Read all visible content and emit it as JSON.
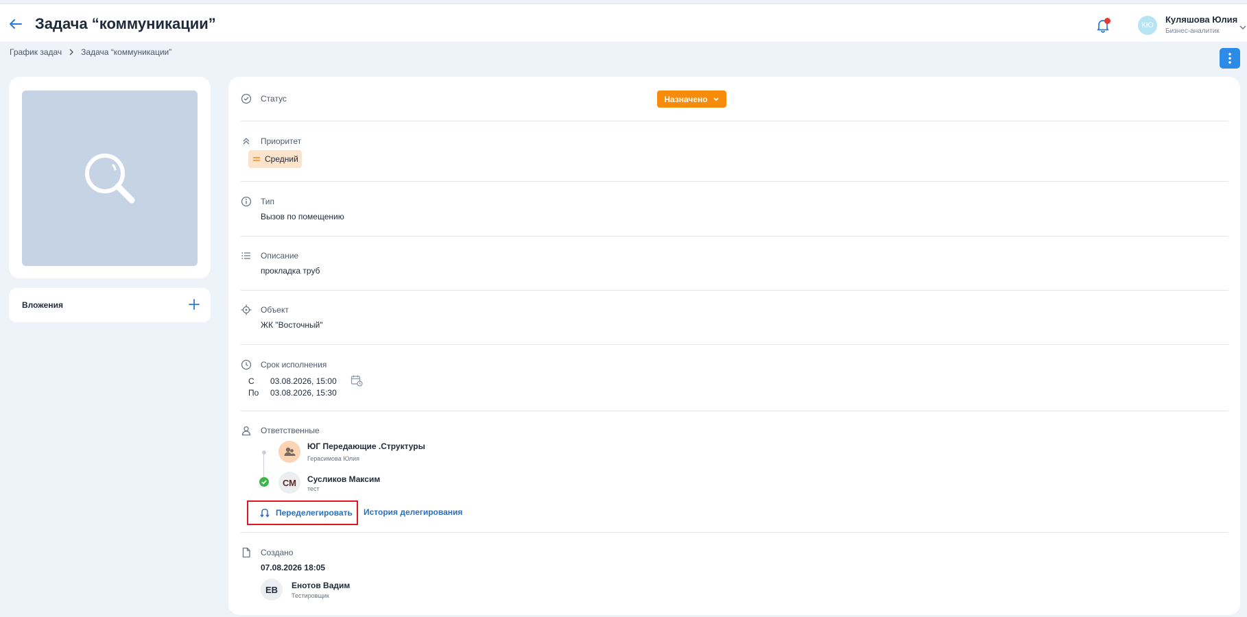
{
  "header": {
    "title": "Задача “коммуникации”",
    "back_icon": "arrow-left-icon",
    "user": {
      "initials": "КЮ",
      "name": "Куляшова Юлия",
      "role": "Бизнес-аналитик"
    }
  },
  "breadcrumb": {
    "items": [
      "График задач",
      "Задача “коммуникации”"
    ]
  },
  "left": {
    "image_icon": "search-icon",
    "attachments_label": "Вложения"
  },
  "details": {
    "status": {
      "label": "Статус",
      "value": "Назначено"
    },
    "priority": {
      "label": "Приоритет",
      "value": "Средний"
    },
    "type": {
      "label": "Тип",
      "value": "Вызов по помещению"
    },
    "description": {
      "label": "Описание",
      "value": "прокладка труб"
    },
    "object": {
      "label": "Объект",
      "value": "ЖК \"Восточный\""
    },
    "deadline": {
      "label": "Срок исполнения",
      "from_label": "С",
      "from_value": "03.08.2026, 15:00",
      "to_label": "По",
      "to_value": "03.08.2026, 15:30"
    },
    "responsible": {
      "label": "Ответственные",
      "people": [
        {
          "name": "ЮГ Передающие .Структуры",
          "sub": "Герасимова Юлия",
          "avatar": "group-icon"
        },
        {
          "initials": "СМ",
          "name": "Сусликов Максим",
          "sub": "тест"
        }
      ],
      "redelegate_label": "Переделегировать",
      "history_label": "История делегирования"
    },
    "created": {
      "label": "Создано",
      "datetime": "07.08.2026 18:05",
      "author": {
        "initials": "ЕВ",
        "name": "Енотов Вадим",
        "role": "Тестировщик"
      }
    }
  },
  "colors": {
    "accent": "#2b8be6",
    "status": "#f68b0c",
    "priority_bg": "#fde3cc",
    "link": "#2a6fc1",
    "highlight_border": "#e3131f",
    "ok_green": "#3bb54a"
  }
}
